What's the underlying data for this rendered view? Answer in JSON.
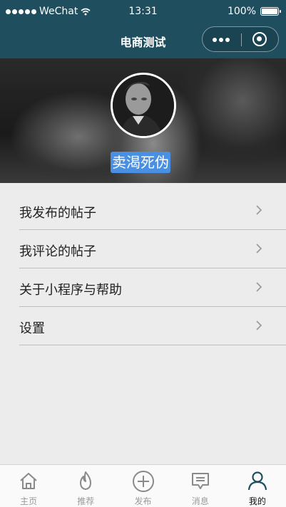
{
  "status_bar": {
    "carrier": "WeChat",
    "time": "13:31",
    "battery": "100%"
  },
  "nav_bar": {
    "title": "电商测试"
  },
  "profile": {
    "nickname": "卖渴死伪"
  },
  "menu": {
    "items": [
      {
        "label": "我发布的帖子"
      },
      {
        "label": "我评论的帖子"
      },
      {
        "label": "关于小程序与帮助"
      },
      {
        "label": "设置"
      }
    ]
  },
  "tab_bar": {
    "tabs": [
      {
        "label": "主页",
        "icon": "home-icon",
        "active": false
      },
      {
        "label": "推荐",
        "icon": "flame-icon",
        "active": false
      },
      {
        "label": "发布",
        "icon": "plus-circle-icon",
        "active": false
      },
      {
        "label": "消息",
        "icon": "message-icon",
        "active": false
      },
      {
        "label": "我的",
        "icon": "user-icon",
        "active": true
      }
    ]
  },
  "colors": {
    "nav": "#1f4e5f",
    "nickname_bg": "#4a90e2",
    "background": "#ececec"
  }
}
